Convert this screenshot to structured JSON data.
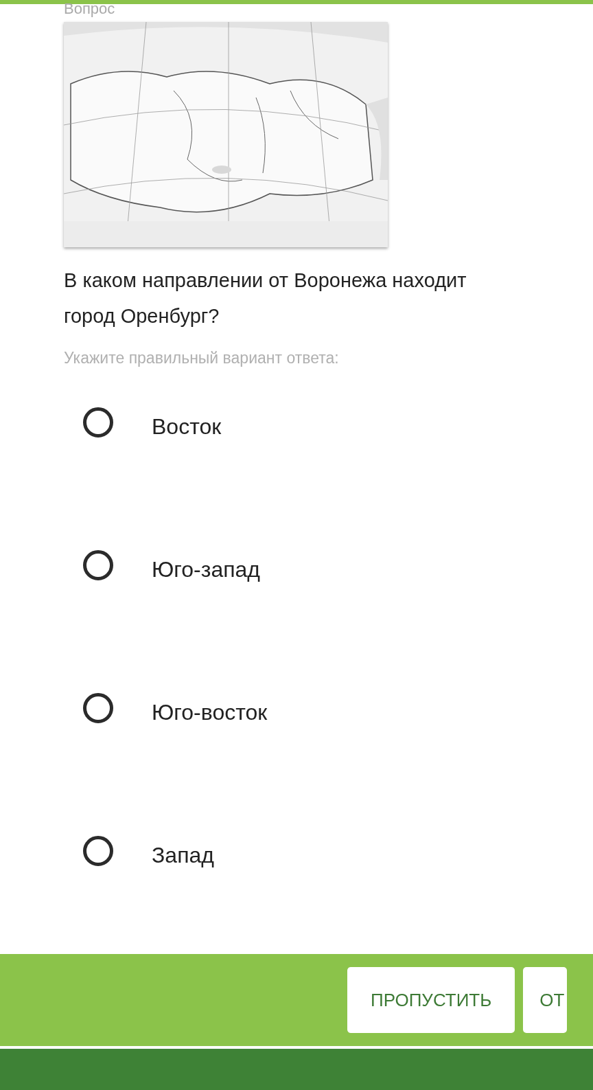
{
  "heading": "Вопрос",
  "question_lines": [
    "В каком направлении от Воронежа находит",
    "город Оренбург?"
  ],
  "hint": "Укажите правильный вариант ответа:",
  "options": [
    {
      "label": "Восток",
      "selected": false
    },
    {
      "label": "Юго-запад",
      "selected": false
    },
    {
      "label": "Юго-восток",
      "selected": false
    },
    {
      "label": "Запад",
      "selected": false
    }
  ],
  "buttons": [
    "ПРОПУСТИТЬ",
    "ОТ"
  ]
}
